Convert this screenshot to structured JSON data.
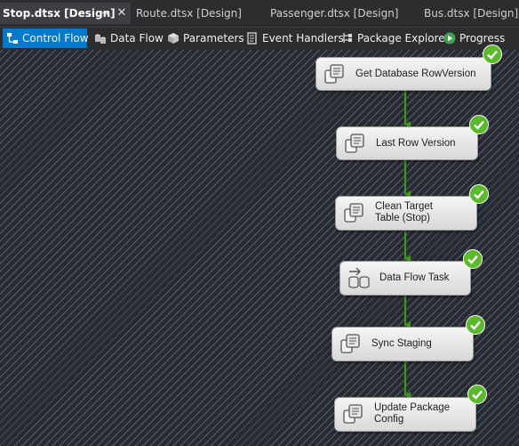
{
  "document_tabs": [
    {
      "label": "Stop.dtsx [Design]",
      "active": true
    },
    {
      "label": "Route.dtsx [Design]",
      "active": false
    },
    {
      "label": "Passenger.dtsx [Design]",
      "active": false
    },
    {
      "label": "Bus.dtsx [Design]",
      "active": false
    }
  ],
  "designer_tabs": [
    {
      "label": "Control Flow",
      "icon": "control-flow-icon",
      "active": true
    },
    {
      "label": "Data Flow",
      "icon": "data-flow-icon",
      "active": false
    },
    {
      "label": "Parameters",
      "icon": "parameters-icon",
      "active": false
    },
    {
      "label": "Event Handlers",
      "icon": "event-handlers-icon",
      "active": false
    },
    {
      "label": "Package Explorer",
      "icon": "package-explorer-icon",
      "active": false
    },
    {
      "label": "Progress",
      "icon": "play-icon",
      "active": false
    }
  ],
  "tasks": [
    {
      "label": "Get Database RowVersion",
      "icon": "execute-sql-task-icon",
      "status": "success"
    },
    {
      "label": "Last Row Version",
      "icon": "execute-sql-task-icon",
      "status": "success"
    },
    {
      "label": "Clean Target\nTable (Stop)",
      "icon": "execute-sql-task-icon",
      "status": "success"
    },
    {
      "label": "Data Flow Task",
      "icon": "data-flow-task-icon",
      "status": "success"
    },
    {
      "label": "Sync Staging",
      "icon": "execute-sql-task-icon",
      "status": "success"
    },
    {
      "label": "Update Package\nConfig",
      "icon": "execute-sql-task-icon",
      "status": "success"
    }
  ],
  "colors": {
    "accent": "#007acc",
    "connector": "#3c9a1a",
    "success": "#5cb82c"
  }
}
